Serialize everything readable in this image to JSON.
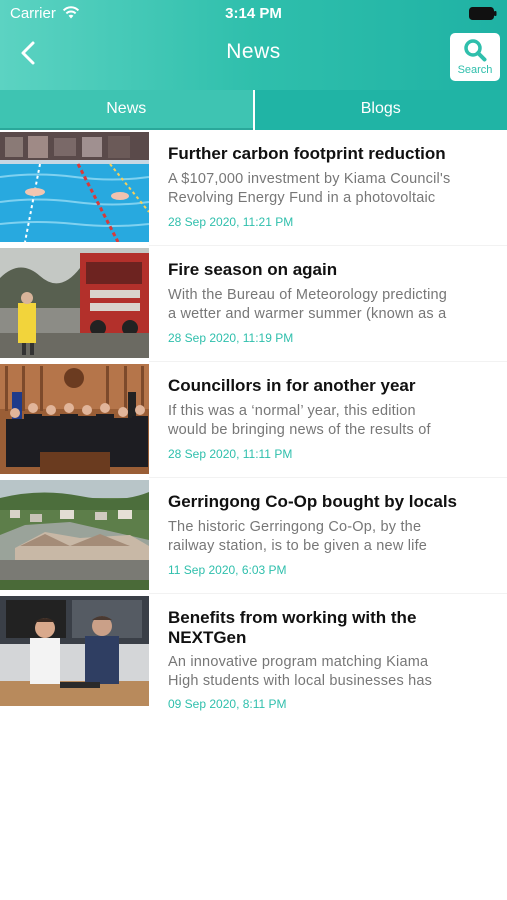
{
  "status_bar": {
    "carrier": "Carrier",
    "time": "3:14 PM"
  },
  "header": {
    "title": "News",
    "search_label": "Search"
  },
  "tabs": [
    {
      "label": "News",
      "selected": true
    },
    {
      "label": "Blogs",
      "selected": false
    }
  ],
  "colors": {
    "accent": "#2fbfac",
    "date": "#2fbfac"
  },
  "articles": [
    {
      "title": "Further carbon footprint reduction",
      "summary_line1": "A $107,000 investment by Kiama Council's",
      "summary_line2": "Revolving Energy Fund in a photovoltaic",
      "date": "28 Sep 2020, 11:21 PM"
    },
    {
      "title": "Fire season on again",
      "summary_line1": "With the Bureau of Meteorology predicting",
      "summary_line2": "a wetter and warmer summer (known as a",
      "date": "28 Sep 2020, 11:19 PM"
    },
    {
      "title": "Councillors in for another year",
      "summary_line1": "If this was a ‘normal’ year, this edition",
      "summary_line2": "would be bringing news of the results of",
      "date": "28 Sep 2020, 11:11 PM"
    },
    {
      "title": "Gerringong Co-Op bought by locals",
      "summary_line1": "The historic Gerringong Co-Op, by the",
      "summary_line2": "railway station, is to be given a new life",
      "date": "11 Sep 2020, 6:03 PM"
    },
    {
      "title_line1": "Benefits from working with the",
      "title_line2": "NEXTGen",
      "summary_line1": "An innovative program matching Kiama",
      "summary_line2": "High students with local businesses has",
      "date": "09 Sep 2020, 8:11 PM"
    }
  ]
}
